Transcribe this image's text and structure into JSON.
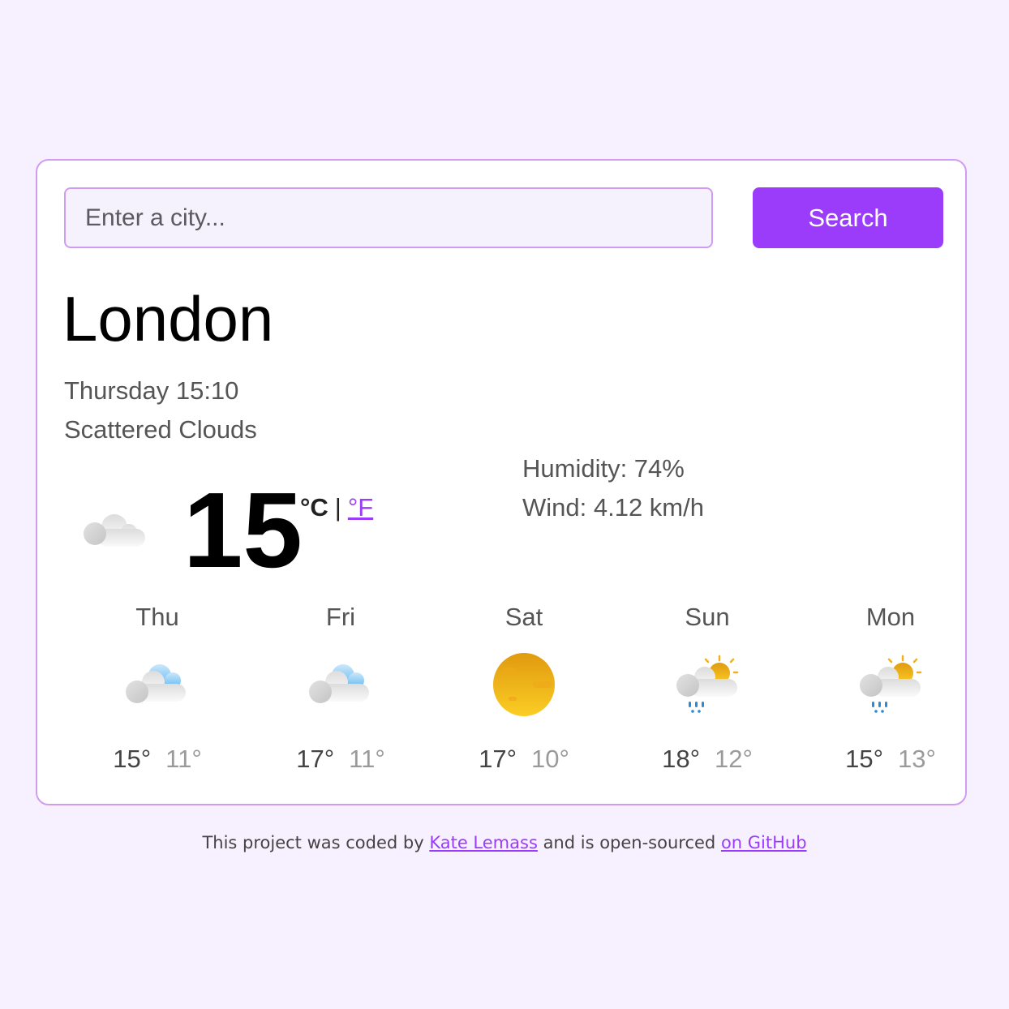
{
  "search": {
    "placeholder": "Enter a city...",
    "value": "",
    "button_label": "Search"
  },
  "current": {
    "city": "London",
    "datetime": "Thursday 15:10",
    "description": "Scattered Clouds",
    "icon": "scattered-clouds-icon",
    "temperature": "15",
    "unit_celsius": "°C",
    "unit_separator": "|",
    "unit_fahrenheit": "°F",
    "humidity": "Humidity: 74%",
    "wind": "Wind: 4.12 km/h"
  },
  "forecast": [
    {
      "day": "Thu",
      "icon": "few-clouds-icon",
      "max": "15°",
      "min": "11°"
    },
    {
      "day": "Fri",
      "icon": "few-clouds-icon",
      "max": "17°",
      "min": "11°"
    },
    {
      "day": "Sat",
      "icon": "clear-sky-sun-icon",
      "max": "17°",
      "min": "10°"
    },
    {
      "day": "Sun",
      "icon": "rain-sun-cloud-icon",
      "max": "18°",
      "min": "12°"
    },
    {
      "day": "Mon",
      "icon": "rain-sun-cloud-icon",
      "max": "15°",
      "min": "13°"
    }
  ],
  "footer": {
    "text_1": "This project was coded by ",
    "author_link": "Kate Lemass",
    "text_2": " and is open-sourced ",
    "github_link": "on GitHub"
  },
  "colors": {
    "accent": "#9b3cfb",
    "border": "#cf9cf2",
    "background": "#f7f0fe"
  }
}
